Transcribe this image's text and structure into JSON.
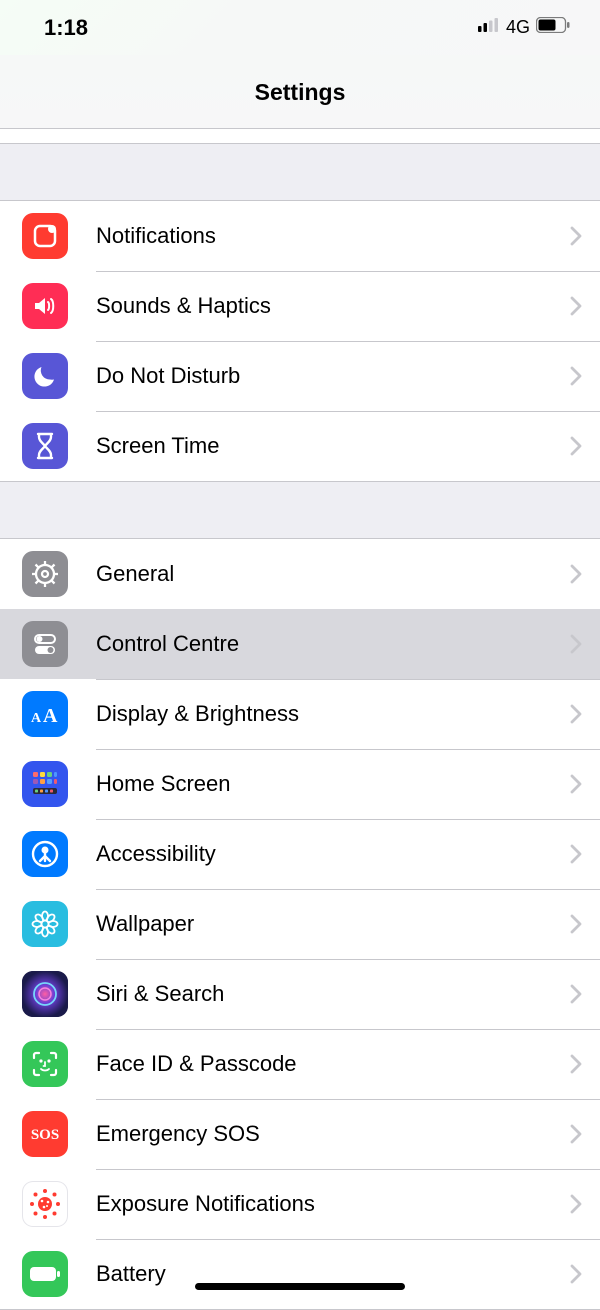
{
  "status": {
    "time": "1:18",
    "network": "4G"
  },
  "header": {
    "title": "Settings"
  },
  "groups": [
    {
      "rows": [
        {
          "id": "notifications",
          "label": "Notifications",
          "iconBg": "#ff3b30",
          "icon": "notif"
        },
        {
          "id": "sounds",
          "label": "Sounds & Haptics",
          "iconBg": "#ff2d55",
          "icon": "speaker"
        },
        {
          "id": "dnd",
          "label": "Do Not Disturb",
          "iconBg": "#5856d6",
          "icon": "moon"
        },
        {
          "id": "screentime",
          "label": "Screen Time",
          "iconBg": "#5856d6",
          "icon": "hourglass"
        }
      ]
    },
    {
      "rows": [
        {
          "id": "general",
          "label": "General",
          "iconBg": "#8e8e93",
          "icon": "gear"
        },
        {
          "id": "controlcentre",
          "label": "Control Centre",
          "iconBg": "#8e8e93",
          "icon": "toggles",
          "selected": true
        },
        {
          "id": "display",
          "label": "Display & Brightness",
          "iconBg": "#007aff",
          "icon": "aa"
        },
        {
          "id": "homescreen",
          "label": "Home Screen",
          "iconBg": "#3355ee",
          "icon": "grid"
        },
        {
          "id": "accessibility",
          "label": "Accessibility",
          "iconBg": "#007aff",
          "icon": "person"
        },
        {
          "id": "wallpaper",
          "label": "Wallpaper",
          "iconBg": "#29bde0",
          "icon": "flower"
        },
        {
          "id": "siri",
          "label": "Siri & Search",
          "iconBg": "#1c1c3a",
          "icon": "siri"
        },
        {
          "id": "faceid",
          "label": "Face ID & Passcode",
          "iconBg": "#34c759",
          "icon": "face"
        },
        {
          "id": "sos",
          "label": "Emergency SOS",
          "iconBg": "#ff3b30",
          "icon": "sos"
        },
        {
          "id": "exposure",
          "label": "Exposure Notifications",
          "iconBg": "#ffffff",
          "icon": "covid",
          "border": true
        },
        {
          "id": "battery",
          "label": "Battery",
          "iconBg": "#34c759",
          "icon": "battery"
        }
      ]
    }
  ]
}
